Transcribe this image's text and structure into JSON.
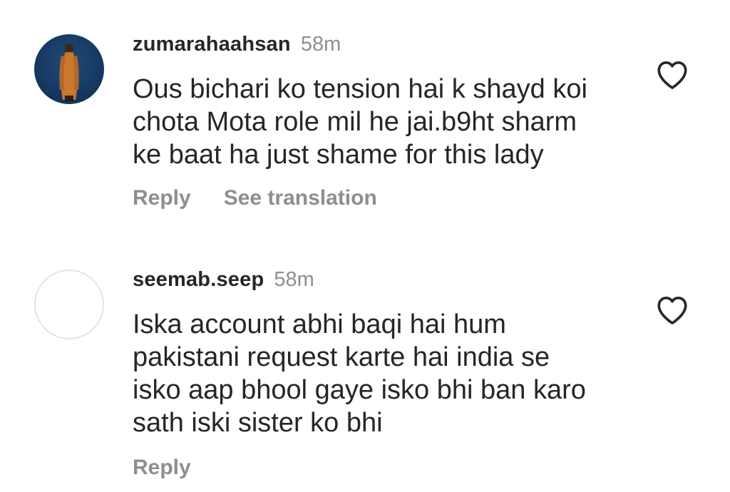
{
  "comments": [
    {
      "username": "zumarahaahsan",
      "time": "58m",
      "text_lines": [
        "Ous bichari ko tension hai k shayd koi",
        "chota Mota role mil he jai.b9ht sharm",
        "ke baat ha just shame for this lady"
      ],
      "actions": {
        "reply": "Reply",
        "translate": "See translation"
      },
      "avatar": "profile-photo",
      "like_icon": "heart-outline-icon"
    },
    {
      "username": "seemab.seep",
      "time": "58m",
      "text_lines": [
        "Iska account abhi baqi hai hum",
        "pakistani request karte hai india se",
        "isko aap bhool gaye isko bhi ban karo",
        "sath iski sister ko bhi"
      ],
      "actions": {
        "reply": "Reply"
      },
      "avatar": "empty-avatar",
      "like_icon": "heart-outline-icon"
    }
  ],
  "colors": {
    "text": "#262626",
    "secondary": "#8e8e8e",
    "avatar_ring": "#e4e4e4"
  }
}
